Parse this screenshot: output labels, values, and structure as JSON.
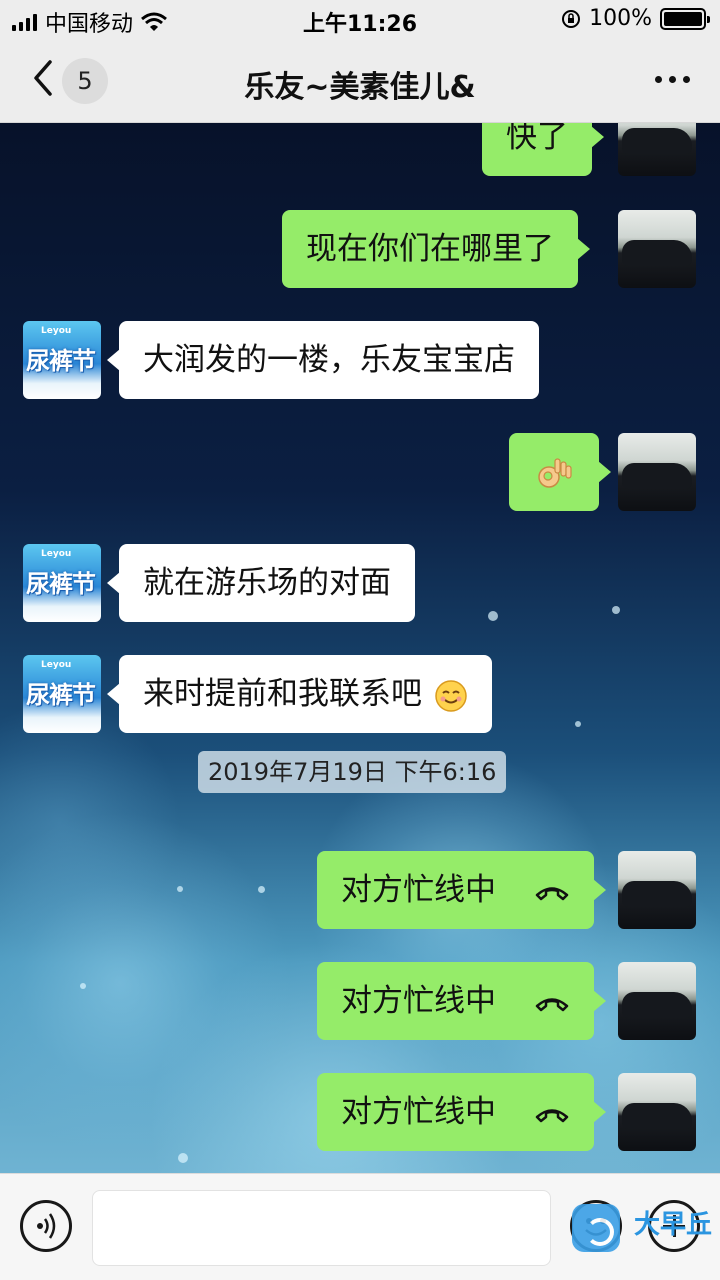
{
  "status_bar": {
    "carrier": "中国移动",
    "time": "上午11:26",
    "battery": "100%"
  },
  "nav": {
    "unread_count": "5",
    "title": "乐友~美素佳儿&"
  },
  "avatar_brand": "Leyou",
  "avatar_big": "尿裤节",
  "messages": {
    "m0": "快了",
    "m1": "现在你们在哪里了",
    "m2": "大润发的一楼，乐友宝宝店",
    "m4": "就在游乐场的对面",
    "m5": "来时提前和我联系吧",
    "timestamp": "2019年7月19日 下午6:16",
    "call1": "对方忙线中",
    "call2": "对方忙线中",
    "call3": "对方忙线中"
  },
  "watermark": "大早丘",
  "icons": {
    "back": "chevron-left-icon",
    "more": "more-dots-icon",
    "call": "phone-hangup-icon",
    "voice": "voice-icon",
    "emoji": "emoji-icon",
    "plus": "plus-icon"
  },
  "colors": {
    "my_bubble": "#95ec69",
    "their_bubble": "#ffffff",
    "topbar": "#ededed"
  }
}
